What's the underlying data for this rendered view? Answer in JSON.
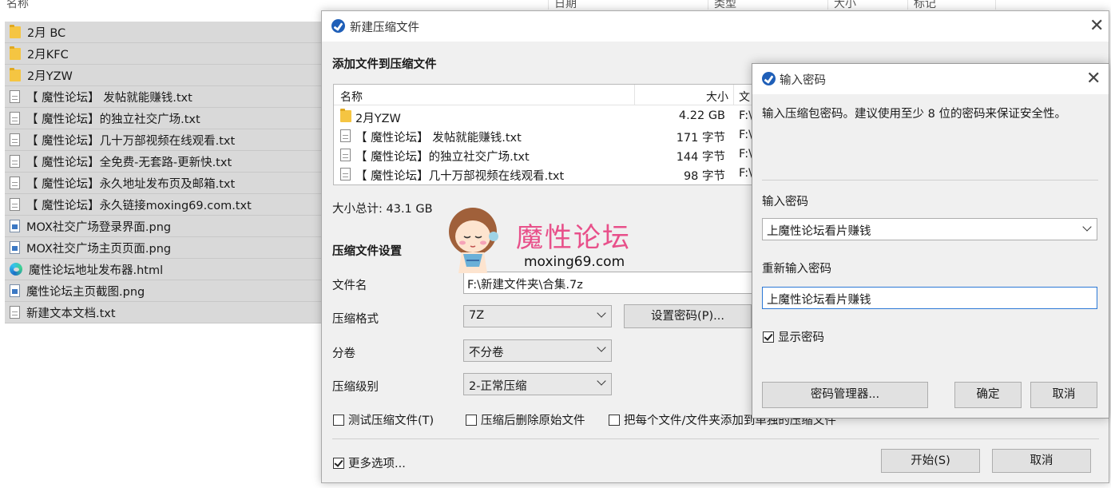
{
  "explorer": {
    "columns": [
      "名称",
      "日期",
      "类型",
      "大小",
      "标记"
    ],
    "files": [
      {
        "icon": "folder-icon",
        "name": "2月 BC"
      },
      {
        "icon": "folder-icon",
        "name": "2月KFC"
      },
      {
        "icon": "folder-icon",
        "name": "2月YZW"
      },
      {
        "icon": "text-file-icon",
        "name": "【 魔性论坛】 发帖就能赚钱.txt"
      },
      {
        "icon": "text-file-icon",
        "name": "【 魔性论坛】的独立社交广场.txt"
      },
      {
        "icon": "text-file-icon",
        "name": "【 魔性论坛】几十万部视频在线观看.txt"
      },
      {
        "icon": "text-file-icon",
        "name": "【 魔性论坛】全免费-无套路-更新快.txt"
      },
      {
        "icon": "text-file-icon",
        "name": "【 魔性论坛】永久地址发布页及邮箱.txt"
      },
      {
        "icon": "text-file-icon",
        "name": "【 魔性论坛】永久链接moxing69.com.txt"
      },
      {
        "icon": "image-file-icon",
        "name": "MOX社交广场登录界面.png"
      },
      {
        "icon": "image-file-icon",
        "name": "MOX社交广场主页页面.png"
      },
      {
        "icon": "edge-browser-icon",
        "name": "魔性论坛地址发布器.html"
      },
      {
        "icon": "image-file-icon",
        "name": "魔性论坛主页截图.png"
      },
      {
        "icon": "text-file-icon",
        "name": "新建文本文档.txt"
      }
    ]
  },
  "archive_dialog": {
    "title": "新建压缩文件",
    "section_add": "添加文件到压缩文件",
    "list_headers": {
      "name": "名称",
      "size": "大小",
      "path": "文"
    },
    "list_rows": [
      {
        "icon": "folder-icon",
        "name": "2月YZW",
        "size": "4.22 GB",
        "path": "F:\\"
      },
      {
        "icon": "text-file-icon",
        "name": "【 魔性论坛】 发帖就能赚钱.txt",
        "size": "171 字节",
        "path": "F:\\"
      },
      {
        "icon": "text-file-icon",
        "name": "【 魔性论坛】的独立社交广场.txt",
        "size": "144 字节",
        "path": "F:\\"
      },
      {
        "icon": "text-file-icon",
        "name": "【 魔性论坛】几十万部视频在线观看.txt",
        "size": "98 字节",
        "path": "F:\\"
      }
    ],
    "total_size": "大小总计: 43.1 GB",
    "section_settings": "压缩文件设置",
    "filename_label": "文件名",
    "filename_value": "F:\\新建文件夹\\合集.7z",
    "format_label": "压缩格式",
    "format_value": "7Z",
    "set_password_button": "设置密码(P)...",
    "split_label": "分卷",
    "split_value": "不分卷",
    "level_label": "压缩级别",
    "level_value": "2-正常压缩",
    "test_archive": "测试压缩文件(T)",
    "delete_after": "压缩后删除原始文件",
    "each_separate": "把每个文件/文件夹添加到单独的压缩文件",
    "more_options": "更多选项...",
    "start_button": "开始(S)",
    "cancel_button": "取消"
  },
  "password_dialog": {
    "title": "输入密码",
    "description": "输入压缩包密码。建议使用至少 8 位的密码来保证安全性。",
    "password_label": "输入密码",
    "password_value": "上魔性论坛看片赚钱",
    "reenter_label": "重新输入密码",
    "reenter_value": "上魔性论坛看片赚钱",
    "show_password": "显示密码",
    "manager_button": "密码管理器...",
    "ok_button": "确定",
    "cancel_button": "取消"
  },
  "watermark": {
    "title": "魔性论坛",
    "url": "moxing69.com"
  }
}
